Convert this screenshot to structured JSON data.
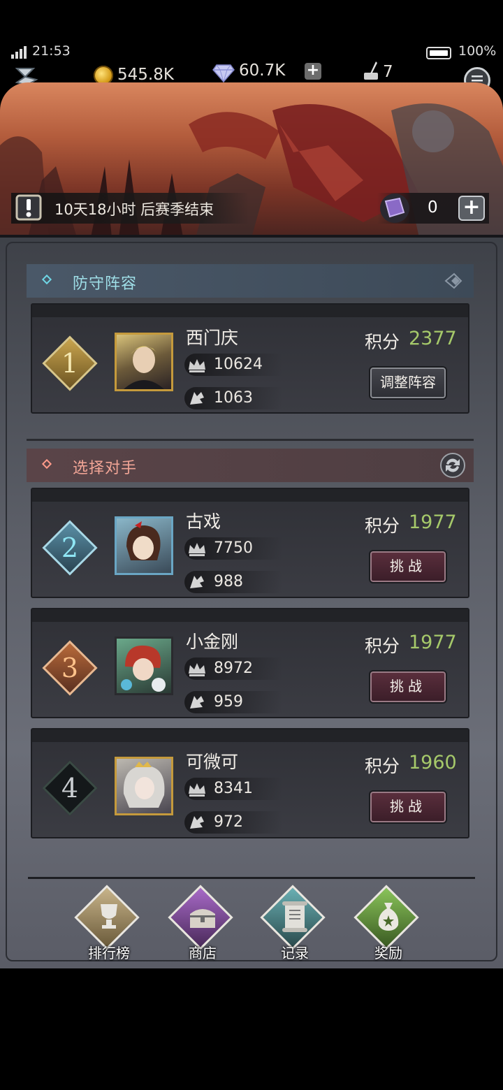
{
  "status": {
    "time": "21:53",
    "battery": "100%"
  },
  "resources": {
    "coins": "545.8K",
    "gems": "60.7K",
    "ink": "7"
  },
  "banner": {
    "season_text": "10天18小时 后赛季结束",
    "scroll_count": "0"
  },
  "defense": {
    "header": "防守阵容",
    "rank": "1",
    "name": "西门庆",
    "power": "10624",
    "wings": "1063",
    "score_label": "积分",
    "score": "2377",
    "button": "调整阵容"
  },
  "opponents_header": "选择对手",
  "opponents": [
    {
      "rank": "2",
      "name": "古戏",
      "power": "7750",
      "wings": "988",
      "score_label": "积分",
      "score": "1977",
      "button": "挑战"
    },
    {
      "rank": "3",
      "name": "小金刚",
      "power": "8972",
      "wings": "959",
      "score_label": "积分",
      "score": "1977",
      "button": "挑战"
    },
    {
      "rank": "4",
      "name": "可微可",
      "power": "8341",
      "wings": "972",
      "score_label": "积分",
      "score": "1960",
      "button": "挑战"
    }
  ],
  "nav": [
    {
      "label": "排行榜",
      "icon": "trophy-icon",
      "color": "#b8a27a"
    },
    {
      "label": "商店",
      "icon": "chest-icon",
      "color": "#8a4aa8"
    },
    {
      "label": "记录",
      "icon": "scroll-icon",
      "color": "#4a8a8e"
    },
    {
      "label": "奖励",
      "icon": "money-bag-icon",
      "color": "#6a9a3a"
    }
  ],
  "colors": {
    "score_green": "#a6c96a",
    "defense_accent": "#6fd7e6",
    "opponent_accent": "#ff9a8a"
  }
}
